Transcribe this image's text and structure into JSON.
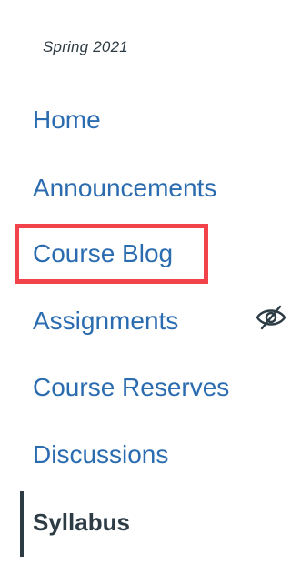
{
  "term": "Spring 2021",
  "nav": {
    "home": "Home",
    "announcements": "Announcements",
    "course_blog": "Course Blog",
    "assignments": "Assignments",
    "course_reserves": "Course Reserves",
    "discussions": "Discussions",
    "syllabus": "Syllabus"
  },
  "icons": {
    "assignments_visibility": "eye-slash-icon"
  },
  "colors": {
    "link": "#2b6cb0",
    "active_text": "#2d3b45",
    "highlight": "#f2434b"
  }
}
